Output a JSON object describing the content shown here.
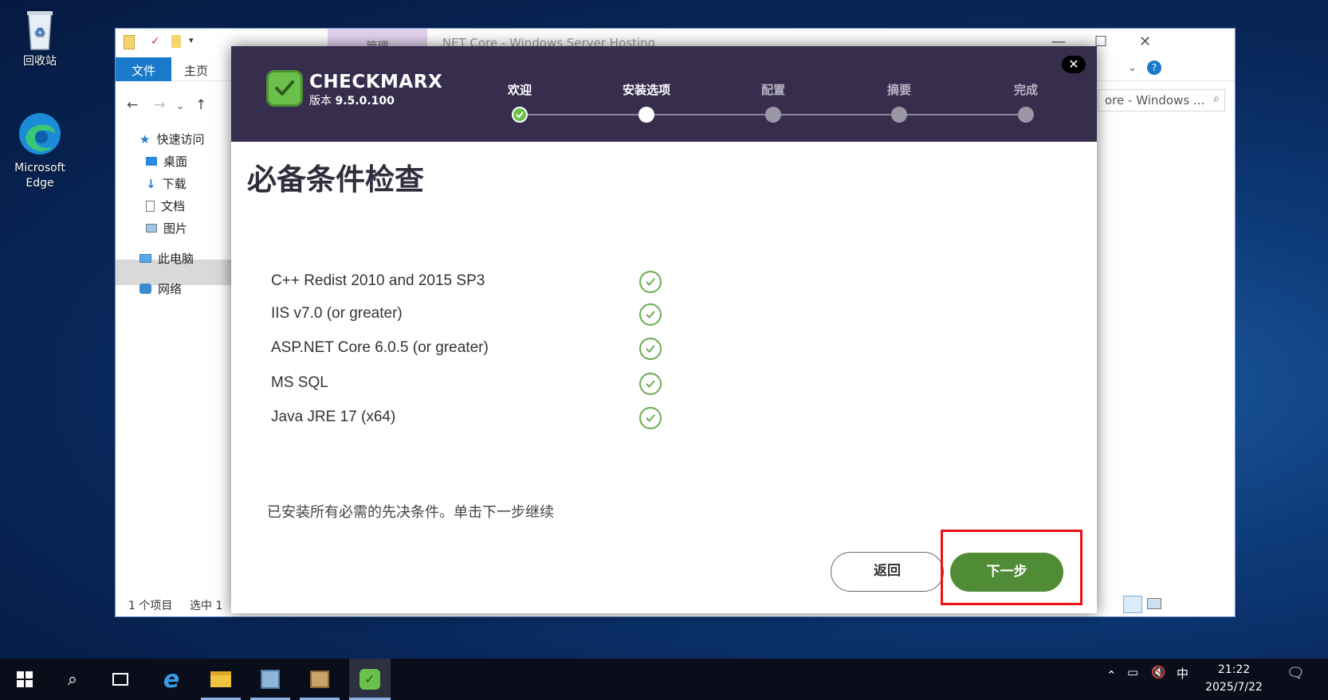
{
  "desktop": {
    "recycle_bin": "回收站",
    "edge_line1": "Microsoft",
    "edge_line2": "Edge"
  },
  "explorer": {
    "manage_tab": "管理",
    "title": ".NET Core - Windows Server Hosting",
    "file_tab": "文件",
    "home_tab": "主页",
    "search_text": "ore - Windows ...",
    "sidebar": {
      "quick_access": "快速访问",
      "desktop": "桌面",
      "downloads": "下载",
      "documents": "文档",
      "pictures": "图片",
      "this_pc": "此电脑",
      "network": "网络"
    },
    "status_items": "1 个项目",
    "status_selected": "选中 1"
  },
  "installer": {
    "brand": "CHECKMARX",
    "version_label": "版本",
    "version_number": "9.5.0.100",
    "steps": [
      "欢迎",
      "安装选项",
      "配置",
      "摘要",
      "完成"
    ],
    "title": "必备条件检查",
    "requirements": [
      "C++ Redist 2010 and 2015 SP3",
      "IIS v7.0 (or greater)",
      "ASP.NET Core 6.0.5 (or greater)",
      "MS SQL",
      "Java JRE 17 (x64)"
    ],
    "footer_message": "已安装所有必需的先决条件。单击下一步继续",
    "back_button": "返回",
    "next_button": "下一步",
    "accent_color": "#4f8c35",
    "header_color": "#372e4e"
  },
  "taskbar": {
    "ime": "中",
    "time": "21:22",
    "date": "2025/7/22"
  }
}
